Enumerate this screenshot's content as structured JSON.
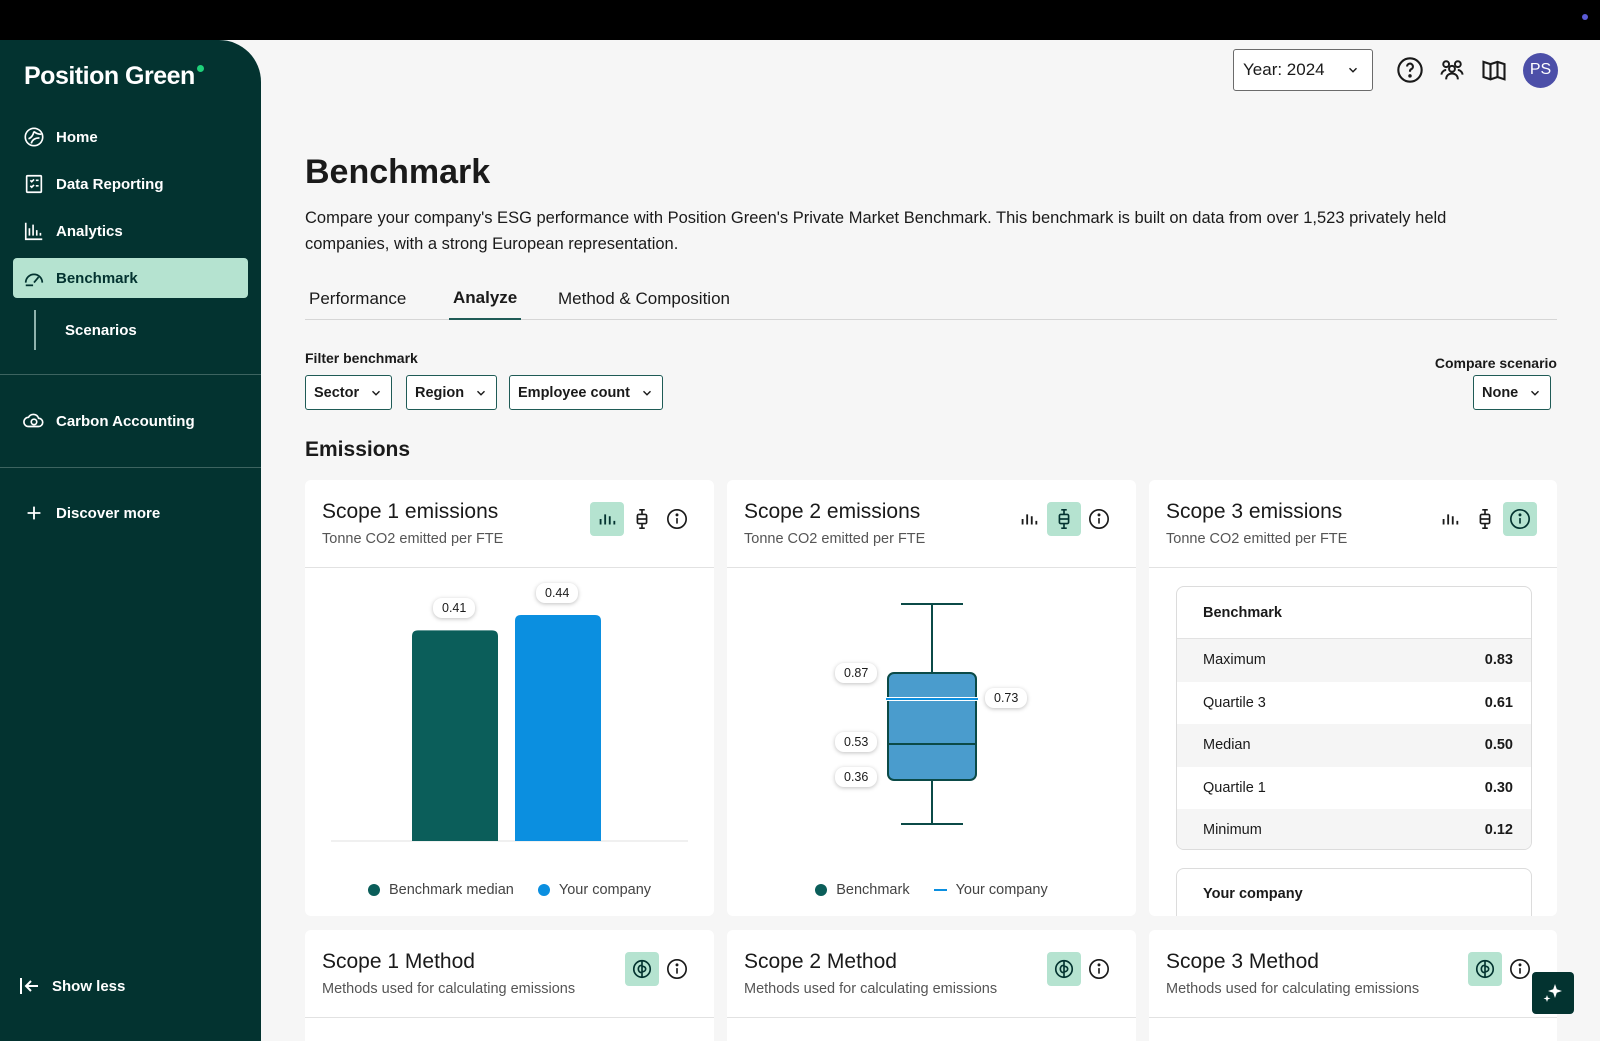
{
  "colors": {
    "sidebar_bg": "#033330",
    "accent_light": "#b5e3d0",
    "benchmark": "#0b5e5a",
    "your_company": "#0b8fe0",
    "box_fill": "#4a9ccd"
  },
  "brand": {
    "name": "Position Green"
  },
  "sidebar": {
    "items": [
      {
        "label": "Home",
        "icon": "home-icon"
      },
      {
        "label": "Data Reporting",
        "icon": "data-reporting-icon"
      },
      {
        "label": "Analytics",
        "icon": "analytics-icon"
      },
      {
        "label": "Benchmark",
        "icon": "benchmark-gauge-icon",
        "active": true
      },
      {
        "label": "Scenarios"
      },
      {
        "label": "Carbon Accounting",
        "icon": "carbon-accounting-icon"
      },
      {
        "label": "Discover more",
        "icon": "plus-icon"
      }
    ],
    "show_less": "Show less"
  },
  "header": {
    "year": "Year: 2024",
    "avatar_initials": "PS"
  },
  "page": {
    "title": "Benchmark",
    "description": "Compare your company's ESG performance with Position Green's Private Market Benchmark. This benchmark is built on data from over 1,523 privately held companies, with a strong European representation.",
    "tabs": [
      "Performance",
      "Analyze",
      "Method & Composition"
    ],
    "active_tab": "Analyze"
  },
  "filters": {
    "label": "Filter benchmark",
    "buttons": [
      "Sector",
      "Region",
      "Employee count"
    ],
    "compare_label": "Compare scenario",
    "compare_value": "None"
  },
  "section": {
    "title": "Emissions"
  },
  "cards": {
    "scope1": {
      "title": "Scope 1 emissions",
      "subtitle": "Tonne CO2 emitted per FTE",
      "legend": [
        "Benchmark median",
        "Your company"
      ]
    },
    "scope2": {
      "title": "Scope 2 emissions",
      "subtitle": "Tonne CO2 emitted per FTE",
      "legend": [
        "Benchmark",
        "Your company"
      ]
    },
    "scope3": {
      "title": "Scope 3 emissions",
      "subtitle": "Tonne CO2 emitted per FTE",
      "table_header": "Benchmark",
      "rows": [
        {
          "label": "Maximum",
          "value": "0.83"
        },
        {
          "label": "Quartile 3",
          "value": "0.61"
        },
        {
          "label": "Median",
          "value": "0.50"
        },
        {
          "label": "Quartile 1",
          "value": "0.30"
        },
        {
          "label": "Minimum",
          "value": "0.12"
        }
      ],
      "your_company_header": "Your company"
    },
    "method1": {
      "title": "Scope 1 Method",
      "subtitle": "Methods used for calculating emissions"
    },
    "method2": {
      "title": "Scope 2 Method",
      "subtitle": "Methods used for calculating emissions"
    },
    "method3": {
      "title": "Scope 3 Method",
      "subtitle": "Methods used for calculating emissions"
    }
  },
  "chart_data": [
    {
      "type": "bar",
      "categories": [
        "Benchmark median",
        "Your company"
      ],
      "values": [
        0.41,
        0.44
      ],
      "ylim": [
        0,
        0.44
      ],
      "grid": false,
      "legend": "bottom"
    },
    {
      "type": "box",
      "box_labels": {
        "q3": 0.87,
        "median": 0.53,
        "q1": 0.36,
        "your_company": 0.73
      },
      "legend": "bottom"
    }
  ]
}
